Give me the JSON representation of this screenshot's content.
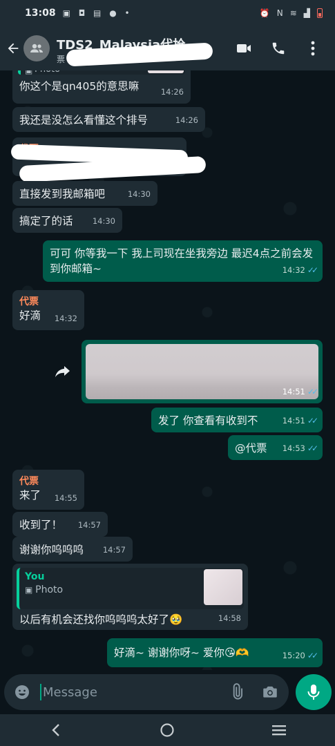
{
  "status_bar": {
    "time": "13:08",
    "battery_color": "#ff6b5e"
  },
  "header": {
    "title": "TDS2_Malaysia代抢",
    "subtitle": "票",
    "icons": [
      "back-arrow-icon",
      "group-avatar-icon",
      "video-call-icon",
      "voice-call-icon",
      "more-options-icon"
    ]
  },
  "messages": [
    {
      "side": "in",
      "quote_label": "Photo",
      "text": "你这个是qn405的意思嘛",
      "time": "14:26"
    },
    {
      "side": "in",
      "text": "我还是没怎么看懂这个排号",
      "time": "14:26"
    },
    {
      "side": "in",
      "sender": "代票",
      "text": "",
      "time": ""
    },
    {
      "side": "in",
      "text": "直接发到我邮箱吧",
      "time": "14:30"
    },
    {
      "side": "in",
      "text": "搞定了的话",
      "time": "14:30"
    },
    {
      "side": "out",
      "text": "可可 你等我一下 我上司现在坐我旁边 最迟4点之前会发到你邮箱~",
      "time": "14:32"
    },
    {
      "side": "in",
      "sender": "代票",
      "text": "好滴",
      "time": "14:32"
    },
    {
      "side": "out",
      "type": "photo",
      "time": "14:51"
    },
    {
      "side": "out",
      "text": "发了 你查看有收到不",
      "time": "14:51"
    },
    {
      "side": "out",
      "text": "@代票",
      "time": "14:53"
    },
    {
      "side": "in",
      "sender": "代票",
      "text": "来了",
      "time": "14:55"
    },
    {
      "side": "in",
      "text": "收到了！",
      "time": "14:57"
    },
    {
      "side": "in",
      "text": "谢谢你呜呜呜",
      "time": "14:57"
    },
    {
      "side": "in",
      "quote_name": "You",
      "quote_label": "Photo",
      "text": "以后有机会还找你呜呜呜太好了🥹",
      "time": "14:58"
    },
    {
      "side": "out",
      "text": "好滴~ 谢谢你呀~ 爱你😘🫶",
      "time": "15:20"
    }
  ],
  "composer": {
    "placeholder": "Message"
  },
  "colors": {
    "incoming_bubble": "#1f2c34",
    "outgoing_bubble": "#005c4b",
    "accent": "#00a884",
    "sender_name": "#ff8a5b",
    "read_tick": "#53bdeb"
  }
}
